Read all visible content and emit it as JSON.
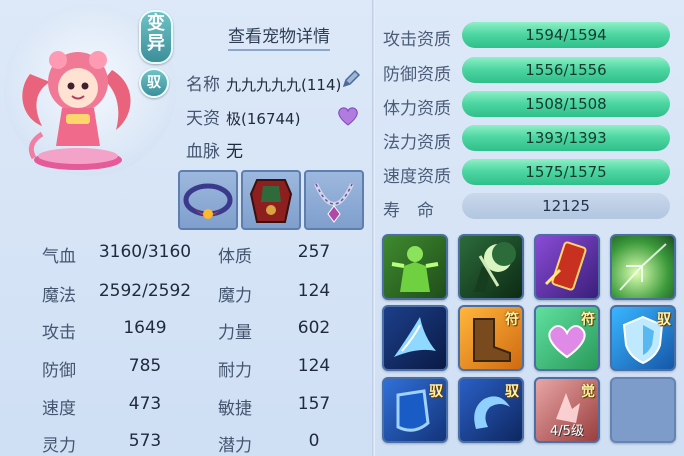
{
  "pet": {
    "mutation_badge": [
      "变",
      "异"
    ],
    "ride_badge": "驭",
    "view_details": "查看宠物详情",
    "name_label": "名称",
    "name_value": "九九九九九(114)",
    "talent_label": "天资",
    "talent_value": "极(16744)",
    "bloodline_label": "血脉",
    "bloodline_value": "无"
  },
  "equipment": [
    "collar-equipment",
    "armor-equipment",
    "necklace-equipment"
  ],
  "stats": [
    {
      "label": "气血",
      "value": "3160/3160"
    },
    {
      "label": "体质",
      "value": "257"
    },
    {
      "label": "魔法",
      "value": "2592/2592"
    },
    {
      "label": "魔力",
      "value": "124"
    },
    {
      "label": "攻击",
      "value": "1649"
    },
    {
      "label": "力量",
      "value": "602"
    },
    {
      "label": "防御",
      "value": "785"
    },
    {
      "label": "耐力",
      "value": "124"
    },
    {
      "label": "速度",
      "value": "473"
    },
    {
      "label": "敏捷",
      "value": "157"
    },
    {
      "label": "灵力",
      "value": "573"
    },
    {
      "label": "潜力",
      "value": "0"
    }
  ],
  "aptitudes": [
    {
      "label": "攻击资质",
      "value": "1594/1594",
      "fill": 1.0
    },
    {
      "label": "防御资质",
      "value": "1556/1556",
      "fill": 1.0
    },
    {
      "label": "体力资质",
      "value": "1508/1508",
      "fill": 1.0
    },
    {
      "label": "法力资质",
      "value": "1393/1393",
      "fill": 1.0
    },
    {
      "label": "速度资质",
      "value": "1575/1575",
      "fill": 1.0
    }
  ],
  "lifespan": {
    "label": "寿　命",
    "value": "12125"
  },
  "skills": [
    {
      "icon": "green-warrior-skill-icon",
      "tag": "",
      "level": ""
    },
    {
      "icon": "moon-knight-skill-icon",
      "tag": "",
      "level": ""
    },
    {
      "icon": "red-scroll-skill-icon",
      "tag": "",
      "level": ""
    },
    {
      "icon": "green-burst-skill-icon",
      "tag": "",
      "level": ""
    },
    {
      "icon": "ice-wing-skill-icon",
      "tag": "",
      "level": ""
    },
    {
      "icon": "boot-talisman-skill-icon",
      "tag": "符",
      "level": ""
    },
    {
      "icon": "heart-talisman-skill-icon",
      "tag": "符",
      "level": ""
    },
    {
      "icon": "shield-ride-skill-icon",
      "tag": "驭",
      "level": ""
    },
    {
      "icon": "blue-shield-ride-skill-icon",
      "tag": "驭",
      "level": ""
    },
    {
      "icon": "blue-swirl-ride-skill-icon",
      "tag": "驭",
      "level": ""
    },
    {
      "icon": "awaken-skill-icon",
      "tag": "觉",
      "level": "4/5级"
    },
    {
      "icon": "empty-skill-slot",
      "tag": "",
      "level": ""
    }
  ],
  "colors": {
    "bar_fill": "#4fd7a3",
    "badge": "#3d8f9a",
    "panel": "#d4e3f6"
  }
}
